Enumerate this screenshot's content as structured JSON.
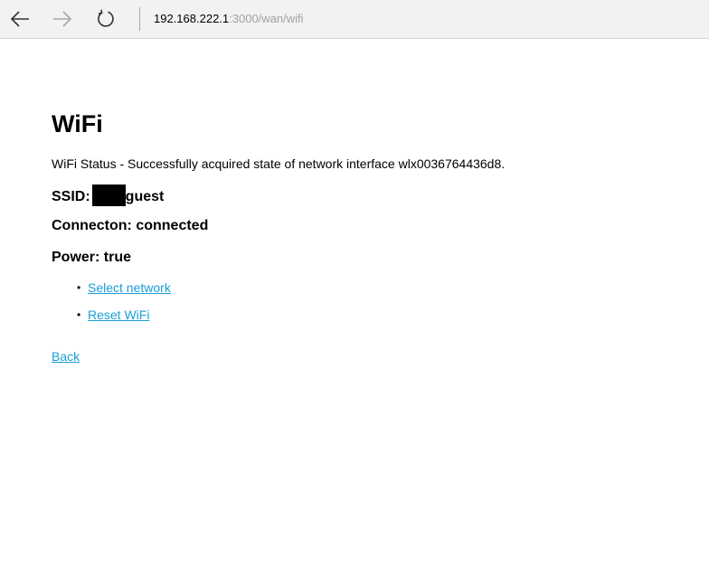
{
  "browser": {
    "address_host": "192.168.222.1",
    "address_rest": ":3000/wan/wifi",
    "icons": [
      "back-arrow-icon",
      "forward-arrow-icon",
      "refresh-icon"
    ]
  },
  "page": {
    "title": "WiFi",
    "status_text": "WiFi Status - Successfully acquired state of network interface wlx0036764436d8.",
    "ssid_label": "SSID:",
    "ssid_value": "guest",
    "connection_text": "Connecton: connected",
    "power_text": "Power: true",
    "links": [
      {
        "label": "Select network"
      },
      {
        "label": "Reset WiFi"
      }
    ],
    "back_label": "Back",
    "link_color": "#1a9ed8"
  }
}
